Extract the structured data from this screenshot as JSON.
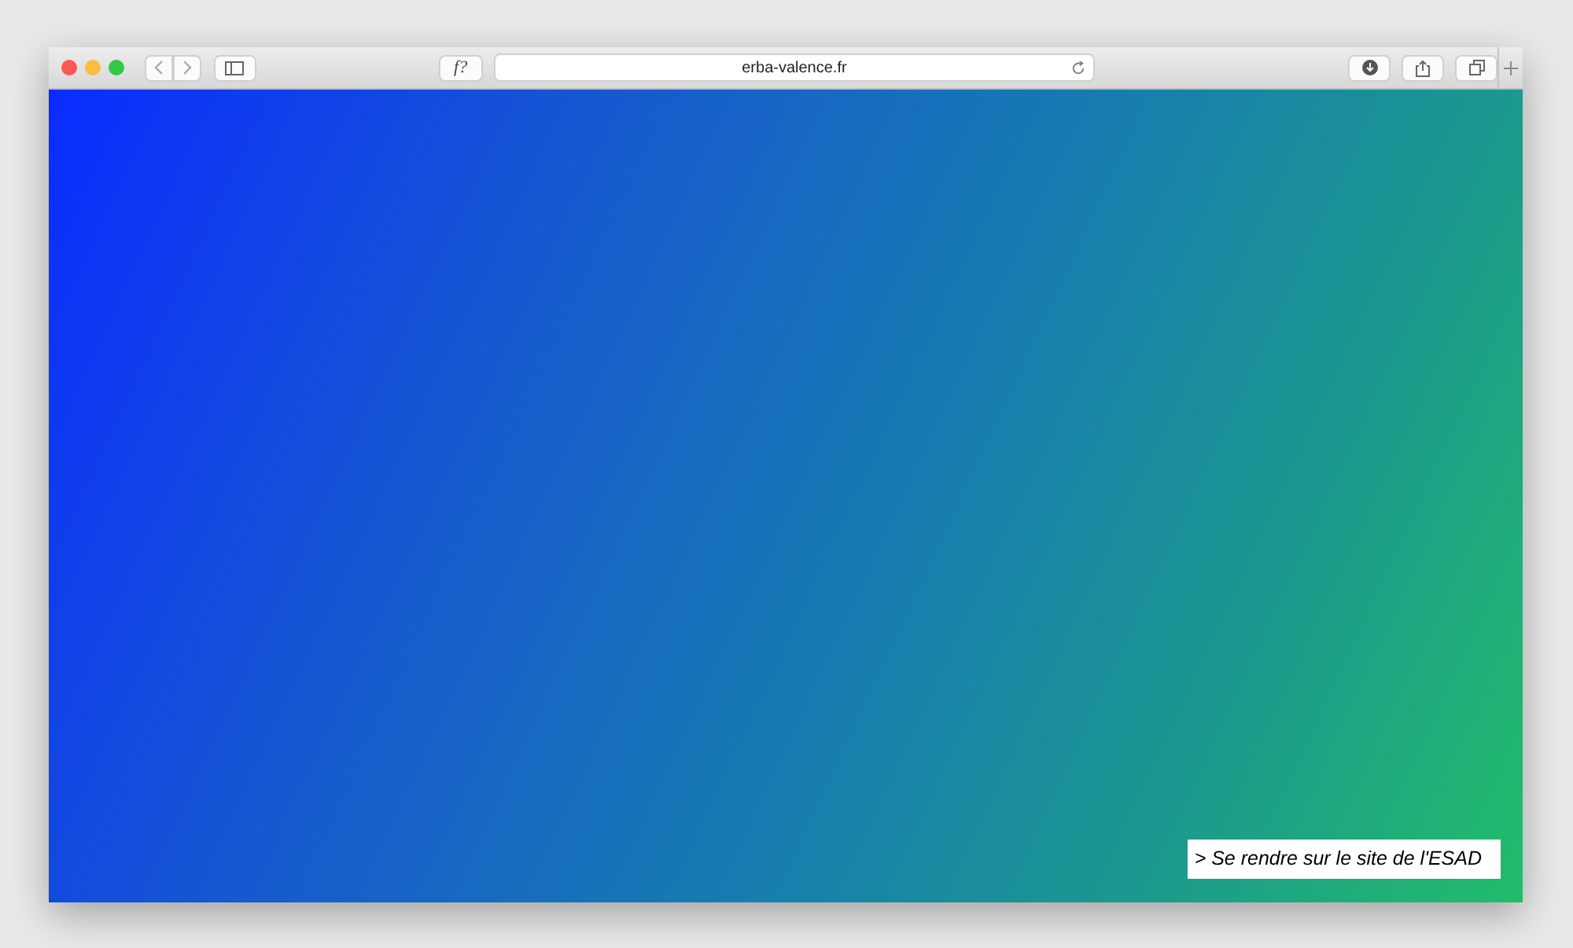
{
  "browser": {
    "address": "erba-valence.fr",
    "extension_button": "f?"
  },
  "page": {
    "link": "> Se rendre sur le site de l'ESAD"
  }
}
